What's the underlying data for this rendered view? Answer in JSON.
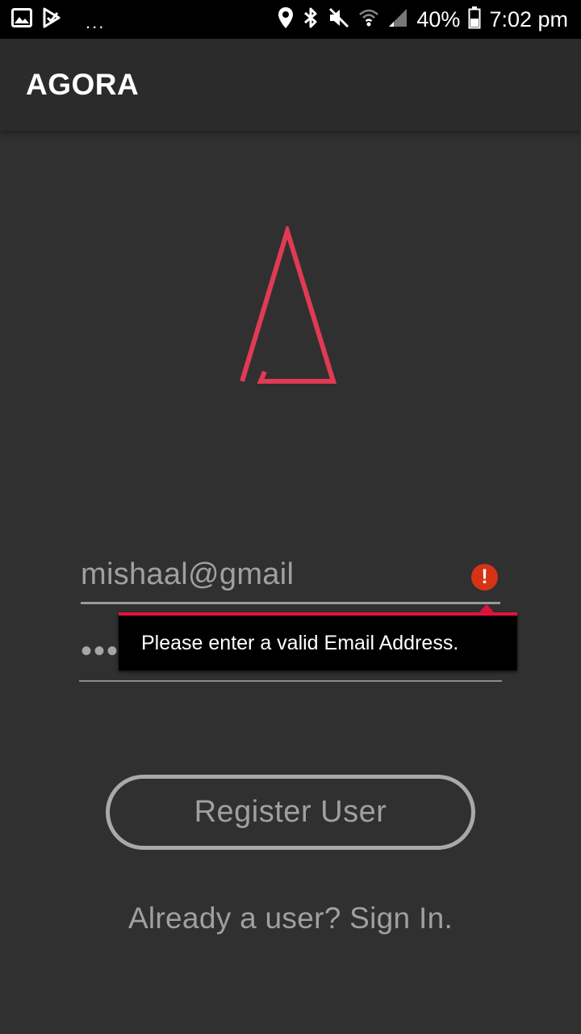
{
  "status_bar": {
    "icons": [
      "image-icon",
      "play-store-icon",
      "location-icon",
      "bluetooth-icon",
      "mute-icon",
      "wifi-icon",
      "signal-icon",
      "battery-icon"
    ],
    "overflow": "...",
    "battery": "40%",
    "time": "7:02 pm"
  },
  "app_bar": {
    "title": "AGORA"
  },
  "logo": {
    "icon": "agora-logo-icon",
    "color": "#e03a55"
  },
  "form": {
    "email_value": "mishaal@gmail",
    "password_mask": "•••",
    "error_message": "Please enter a valid Email Address.",
    "error_color": "#e2133c",
    "register_label": "Register User",
    "signin_text": "Already a user? Sign In."
  }
}
